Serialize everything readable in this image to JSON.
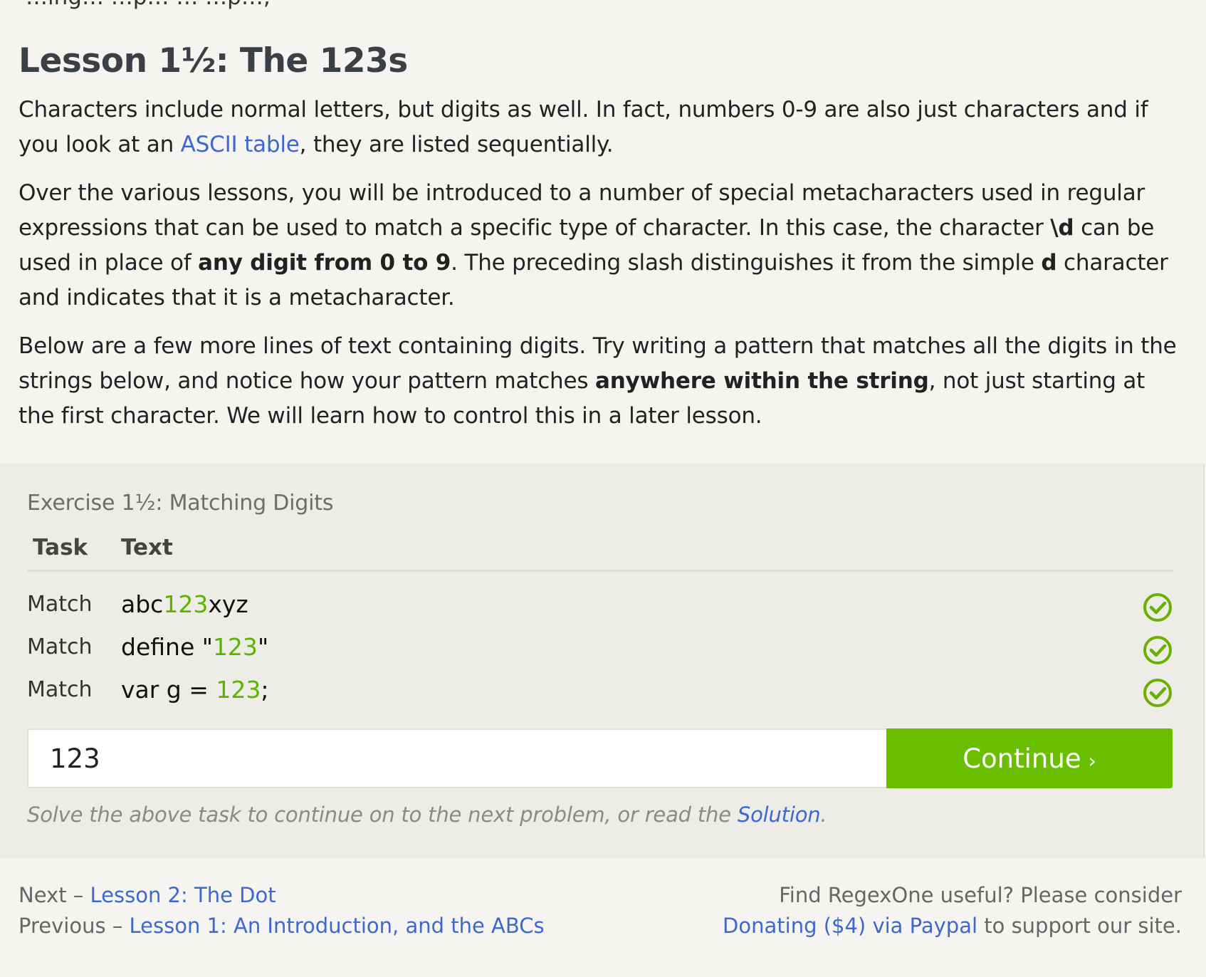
{
  "top_fragment": "…ing… …p… … …p…,",
  "lesson": {
    "title": "Lesson 1½: The 123s",
    "p1": {
      "before": "Characters include normal letters, but digits as well. In fact, numbers 0-9 are also just characters and if you look at an ",
      "link": "ASCII table",
      "after": ", they are listed sequentially."
    },
    "p2": {
      "t1": "Over the various lessons, you will be introduced to a number of special metacharacters used in regular expressions that can be used to match a specific type of character. In this case, the character ",
      "b1": "\\d",
      "t2": " can be used in place of ",
      "b2": "any digit from 0 to 9",
      "t3": ". The preceding slash distinguishes it from the simple ",
      "b3": "d",
      "t4": " character and indicates that it is a metacharacter."
    },
    "p3": {
      "t1": "Below are a few more lines of text containing digits. Try writing a pattern that matches all the digits in the strings below, and notice how your pattern matches ",
      "b1": "anywhere within the string",
      "t2": ", not just starting at the first character. We will learn how to control this in a later lesson."
    }
  },
  "exercise": {
    "title": "Exercise 1½: Matching Digits",
    "col_task": "Task",
    "col_text": "Text",
    "rows": [
      {
        "task": "Match",
        "pre": "abc",
        "hl": "123",
        "post": "xyz",
        "status": "check-icon"
      },
      {
        "task": "Match",
        "pre": "define \"",
        "hl": "123",
        "post": "\"",
        "status": "check-icon"
      },
      {
        "task": "Match",
        "pre": "var g = ",
        "hl": "123",
        "post": ";",
        "status": "check-icon"
      }
    ],
    "input_value": "123",
    "continue_label": "Continue",
    "continue_chevron": "›",
    "hint_before": "Solve the above task to continue on to the next problem, or read the ",
    "hint_link": "Solution",
    "hint_after": "."
  },
  "footer": {
    "next_label": "Next – ",
    "next_link": "Lesson 2: The Dot",
    "prev_label": "Previous – ",
    "prev_link": "Lesson 1: An Introduction, and the ABCs",
    "donate_line1": "Find RegexOne useful? Please consider",
    "donate_link": "Donating ($4) via Paypal",
    "donate_after": " to support our site."
  },
  "colors": {
    "accent_green": "#6ac000",
    "match_green": "#5cb300",
    "link_blue": "#3c68d0"
  }
}
